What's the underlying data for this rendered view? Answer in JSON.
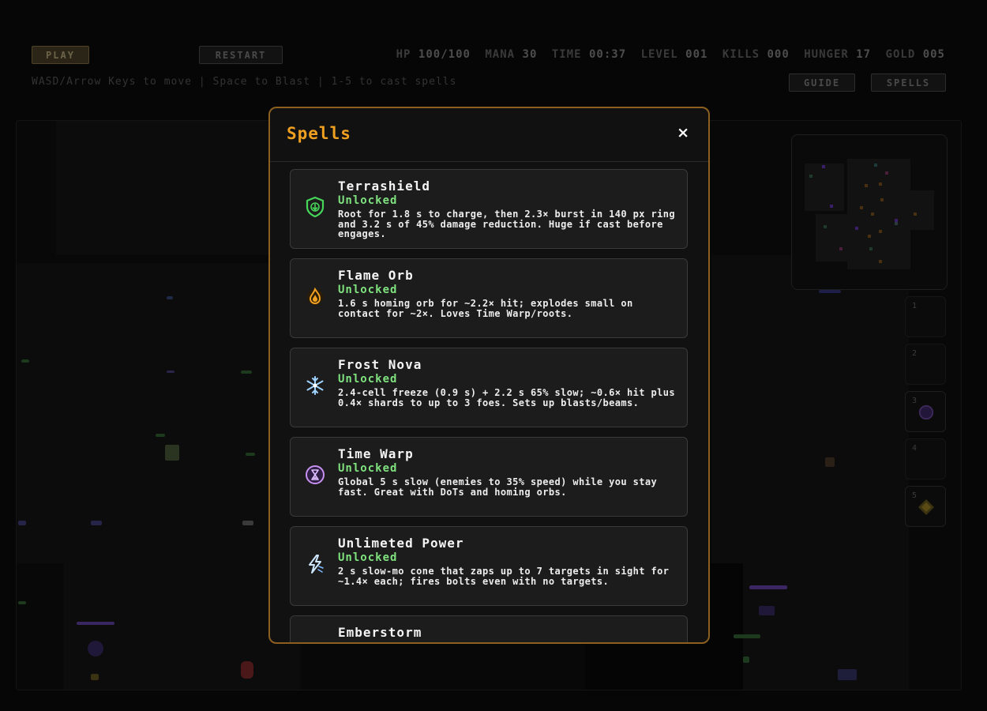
{
  "hud": {
    "play_label": "PLAY",
    "restart_label": "RESTART",
    "guide_label": "GUIDE",
    "spells_label": "SPELLS",
    "controls_text": "WASD/Arrow Keys to move | Space to Blast | 1-5 to cast spells",
    "stats": {
      "hp_label": "HP",
      "hp_value": "100/100",
      "mana_label": "MANA",
      "mana_value": "30",
      "time_label": "TIME",
      "time_value": "00:37",
      "level_label": "LEVEL",
      "level_value": "001",
      "kills_label": "KILLS",
      "kills_value": "000",
      "hunger_label": "HUNGER",
      "hunger_value": "17",
      "gold_label": "GOLD",
      "gold_value": "005"
    }
  },
  "hotbar": {
    "slots": [
      {
        "number": "1",
        "icon": "empty"
      },
      {
        "number": "2",
        "icon": "empty"
      },
      {
        "number": "3",
        "icon": "time-warp-icon"
      },
      {
        "number": "4",
        "icon": "empty"
      },
      {
        "number": "5",
        "icon": "diamond-spark-icon"
      }
    ]
  },
  "modal": {
    "title": "Spells",
    "close_label": "×",
    "spells": [
      {
        "name": "Terrashield",
        "status": "Unlocked",
        "icon": "shield-icon",
        "color": "#46d65a",
        "description": "Root for 1.8 s to charge, then 2.3× burst in 140 px ring and 3.2 s of 45% damage reduction. Huge if cast before engages."
      },
      {
        "name": "Flame Orb",
        "status": "Unlocked",
        "icon": "flame-icon",
        "color": "#f0a020",
        "description": "1.6 s homing orb for ~2.2× hit; explodes small on contact for ~2×. Loves Time Warp/roots."
      },
      {
        "name": "Frost Nova",
        "status": "Unlocked",
        "icon": "snowflake-icon",
        "color": "#9fd2ff",
        "description": "2.4-cell freeze (0.9 s) + 2.2 s 65% slow; ~0.6× hit plus 0.4× shards to up to 3 foes. Sets up blasts/beams."
      },
      {
        "name": "Time Warp",
        "status": "Unlocked",
        "icon": "hourglass-icon",
        "color": "#c890f0",
        "description": "Global 5 s slow (enemies to 35% speed) while you stay fast. Great with DoTs and homing orbs."
      },
      {
        "name": "Unlimeted Power",
        "status": "Unlocked",
        "icon": "lightning-icon",
        "color": "#cfe8ff",
        "description": "2 s slow-mo cone that zaps up to 7 targets in sight for ~1.4× each; fires bolts even with no targets."
      },
      {
        "name": "Emberstorm",
        "status": "",
        "icon": "",
        "color": "#f0a020",
        "description": ""
      }
    ]
  },
  "colors": {
    "accent": "#f0a020",
    "modal_border": "#8a5f20",
    "unlocked": "#7fe27f"
  }
}
